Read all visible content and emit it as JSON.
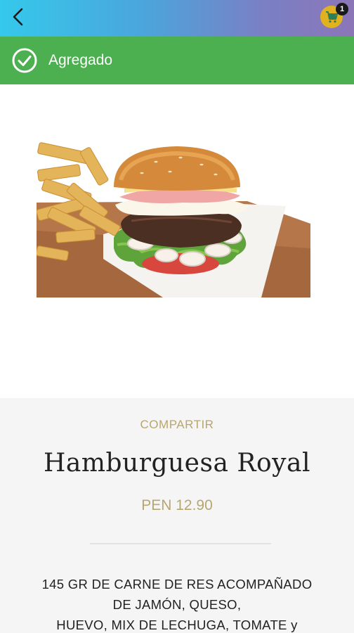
{
  "header": {
    "back_icon": "chevron-left-icon",
    "cart_icon": "shopping-cart-icon",
    "cart_count": "1",
    "accent_color": "#e0b21f",
    "gradient": [
      "#35c9ec",
      "#8b76b8"
    ]
  },
  "toast": {
    "icon": "check-circle-icon",
    "message": "Agregado",
    "color": "#4caf50"
  },
  "product": {
    "share_label": "COMPARTIR",
    "name": "Hamburguesa Royal",
    "price": "PEN 12.90",
    "description_lines": [
      "145 GR DE CARNE DE RES ACOMPAÑADO",
      "DE JAMÓN, QUESO,",
      "HUEVO, MIX DE LECHUGA, TOMATE y"
    ],
    "gold_color": "#b8a670"
  }
}
